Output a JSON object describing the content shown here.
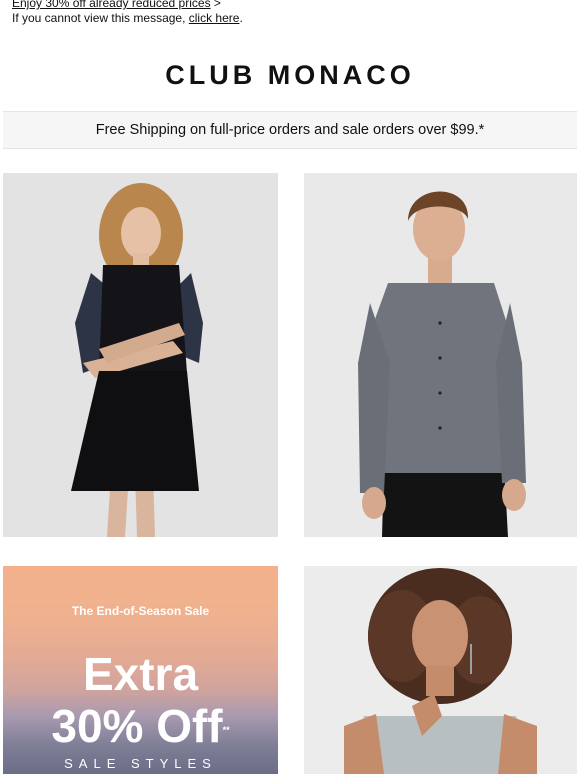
{
  "preheader": {
    "offer_link": "Enjoy 30% off already reduced prices",
    "offer_arrow": ">",
    "view_text": "If you cannot view this message, ",
    "view_link": "click here",
    "view_suffix": "."
  },
  "brand": {
    "name": "CLUB MONACO"
  },
  "shipping": {
    "text": "Free Shipping on full-price orders and sale orders over $99.*"
  },
  "promo": {
    "kicker": "The End-of-Season Sale",
    "line1": "Extra",
    "line2": "30% Off",
    "line2_mark": "**",
    "line3": "SALE STYLES"
  },
  "images": [
    {
      "name": "woman-black-dress-photo"
    },
    {
      "name": "man-grey-shirt-photo"
    },
    {
      "name": "woman-curly-hair-top-photo"
    }
  ],
  "colors": {
    "promo_gradient_top": "#f4b08c",
    "promo_gradient_bottom": "#6b6c86",
    "shipping_bar_bg": "#f7f6f6"
  }
}
